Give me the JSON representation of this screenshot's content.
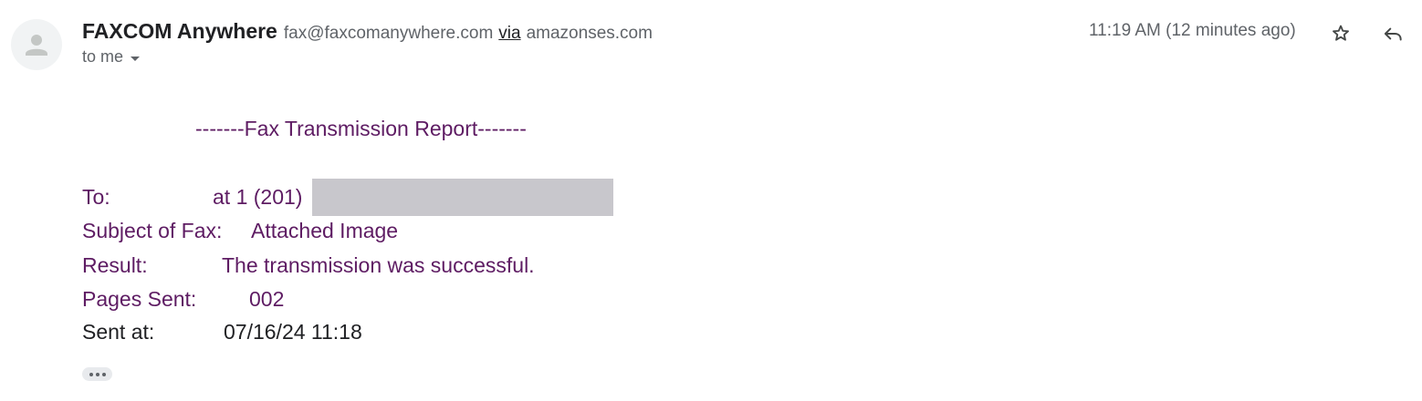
{
  "email": {
    "sender_name": "FAXCOM Anywhere",
    "sender_email": "fax@faxcomanywhere.com",
    "via_label": "via",
    "via_domain": "amazonses.com",
    "recipient_label": "to me",
    "timestamp": "11:19 AM (12 minutes ago)"
  },
  "report": {
    "title": "-------Fax Transmission Report-------",
    "to_label": "To:",
    "to_value": "at 1 (201)",
    "subject_label": "Subject of Fax:",
    "subject_value": "Attached Image",
    "result_label": "Result:",
    "result_value": "The transmission was successful.",
    "pages_label": "Pages Sent:",
    "pages_value": "002",
    "sent_label": "Sent at:",
    "sent_value": "07/16/24 11:18"
  },
  "icons": {
    "avatar": "person-icon",
    "star": "star-icon",
    "reply": "reply-icon",
    "more": "more-horizontal-icon"
  },
  "colors": {
    "report_text": "#5e1c63",
    "secondary_text": "#5f6368",
    "primary_text": "#202124"
  }
}
